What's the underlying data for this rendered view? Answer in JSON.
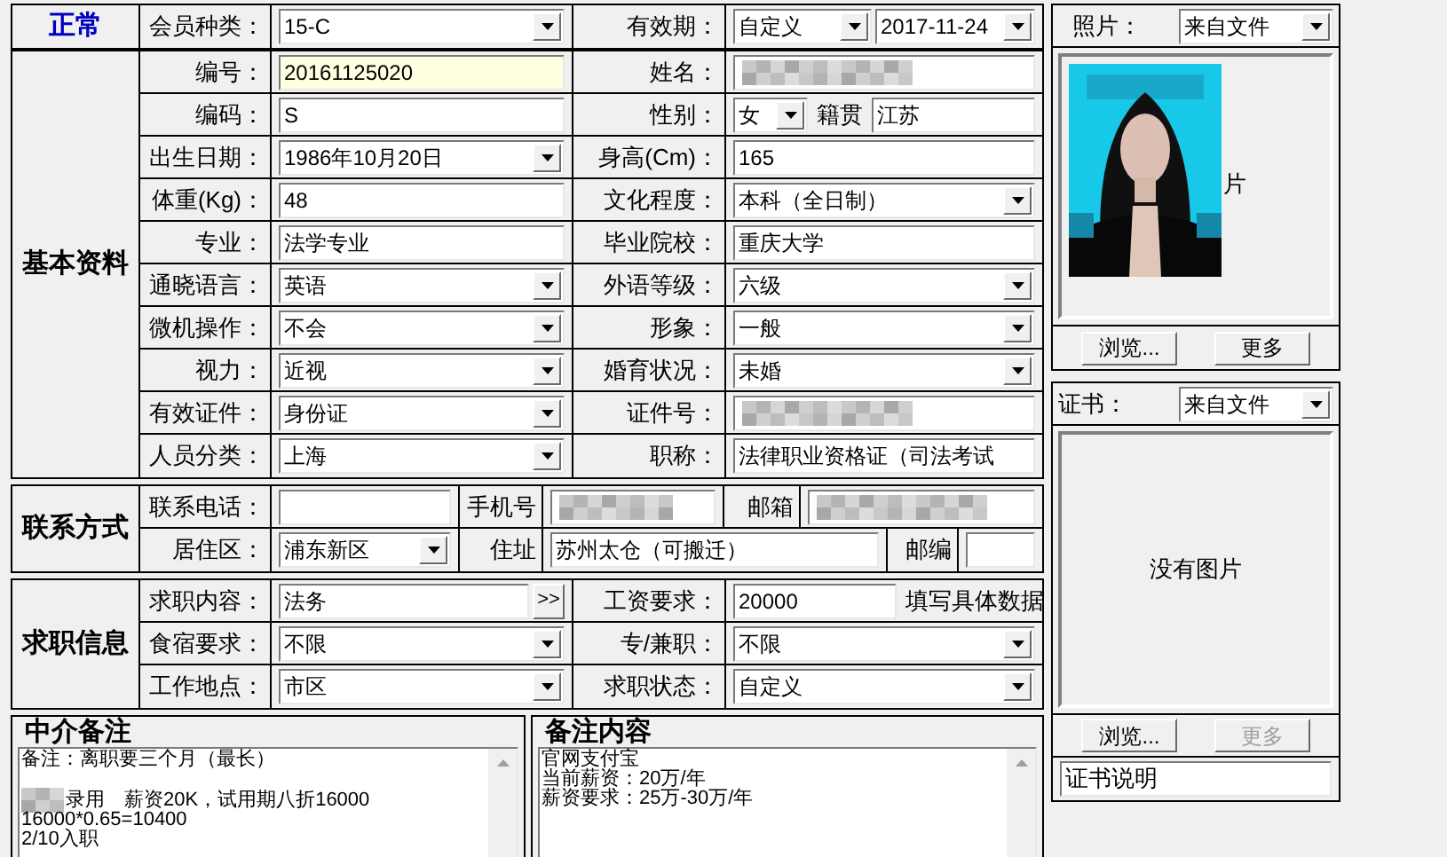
{
  "header": {
    "status": "正常",
    "cells": [
      {
        "label": "会员种类："
      },
      {
        "controls": [
          {
            "kind": "select",
            "value": "15-C"
          }
        ]
      },
      {
        "label": "有效期："
      },
      {
        "controls": [
          {
            "kind": "select_small",
            "value": "自定义"
          },
          {
            "kind": "select",
            "value": "2017-11-24"
          }
        ]
      }
    ]
  },
  "sections": [
    {
      "title": "基本资料",
      "kind": "form",
      "rows": [
        [
          {
            "label": "编号："
          },
          {
            "controls": [
              {
                "kind": "input_highlight",
                "value": "20161125020"
              }
            ]
          },
          {
            "label": "姓名："
          },
          {
            "controls": [
              {
                "kind": "redacted"
              }
            ]
          }
        ],
        [
          {
            "label": "编码："
          },
          {
            "controls": [
              {
                "kind": "input",
                "value": "S"
              }
            ]
          },
          {
            "label": "性别："
          },
          {
            "controls": [
              {
                "kind": "select_tiny",
                "value": "女"
              },
              {
                "kind": "caption",
                "text": "籍贯"
              },
              {
                "kind": "input",
                "value": "江苏"
              }
            ]
          }
        ],
        [
          {
            "label": "出生日期："
          },
          {
            "controls": [
              {
                "kind": "select",
                "value": "1986年10月20日"
              }
            ]
          },
          {
            "label": "身高(Cm)："
          },
          {
            "controls": [
              {
                "kind": "input",
                "value": "165"
              }
            ]
          }
        ],
        [
          {
            "label": "体重(Kg)："
          },
          {
            "controls": [
              {
                "kind": "input",
                "value": "48"
              }
            ]
          },
          {
            "label": "文化程度："
          },
          {
            "controls": [
              {
                "kind": "select",
                "value": "本科（全日制）"
              }
            ]
          }
        ],
        [
          {
            "label": "专业："
          },
          {
            "controls": [
              {
                "kind": "input",
                "value": "法学专业"
              }
            ]
          },
          {
            "label": "毕业院校："
          },
          {
            "controls": [
              {
                "kind": "input",
                "value": "重庆大学"
              }
            ]
          }
        ],
        [
          {
            "label": "通晓语言："
          },
          {
            "controls": [
              {
                "kind": "select",
                "value": "英语"
              }
            ]
          },
          {
            "label": "外语等级："
          },
          {
            "controls": [
              {
                "kind": "select",
                "value": "六级"
              }
            ]
          }
        ],
        [
          {
            "label": "微机操作："
          },
          {
            "controls": [
              {
                "kind": "select",
                "value": "不会"
              }
            ]
          },
          {
            "label": "形象："
          },
          {
            "controls": [
              {
                "kind": "select",
                "value": "一般"
              }
            ]
          }
        ],
        [
          {
            "label": "视力："
          },
          {
            "controls": [
              {
                "kind": "select",
                "value": "近视"
              }
            ]
          },
          {
            "label": "婚育状况："
          },
          {
            "controls": [
              {
                "kind": "select",
                "value": "未婚"
              }
            ]
          }
        ],
        [
          {
            "label": "有效证件："
          },
          {
            "controls": [
              {
                "kind": "select",
                "value": "身份证"
              }
            ]
          },
          {
            "label": "证件号："
          },
          {
            "controls": [
              {
                "kind": "redacted"
              }
            ]
          }
        ],
        [
          {
            "label": "人员分类："
          },
          {
            "controls": [
              {
                "kind": "select",
                "value": "上海"
              }
            ]
          },
          {
            "label": "职称："
          },
          {
            "controls": [
              {
                "kind": "input",
                "value": "法律职业资格证（司法考试"
              }
            ]
          }
        ]
      ]
    },
    {
      "title": "联系方式",
      "kind": "contact",
      "rows": [
        [
          {
            "label": "联系电话："
          },
          {
            "controls": [
              {
                "kind": "input"
              }
            ]
          },
          {
            "label": "手机号"
          },
          {
            "controls": [
              {
                "kind": "redacted"
              }
            ]
          },
          {
            "label": "邮箱"
          },
          {
            "controls": [
              {
                "kind": "redacted"
              }
            ]
          }
        ],
        [
          {
            "label": "居住区："
          },
          {
            "controls": [
              {
                "kind": "select",
                "value": "浦东新区"
              }
            ]
          },
          {
            "label": "住址"
          },
          {
            "controls": [
              {
                "kind": "input",
                "value": "苏州太仓（可搬迁）"
              }
            ]
          },
          {
            "label": "邮编"
          },
          {
            "controls": [
              {
                "kind": "input"
              }
            ]
          }
        ]
      ]
    },
    {
      "title": "求职信息",
      "kind": "form",
      "rows": [
        [
          {
            "label": "求职内容："
          },
          {
            "controls": [
              {
                "kind": "input",
                "value": "法务"
              },
              {
                "kind": "button",
                "text": ">>"
              }
            ]
          },
          {
            "label": "工资要求："
          },
          {
            "controls": [
              {
                "kind": "input_short",
                "value": "20000"
              },
              {
                "kind": "caption",
                "text": "填写具体数据"
              }
            ]
          }
        ],
        [
          {
            "label": "食宿要求："
          },
          {
            "controls": [
              {
                "kind": "select",
                "value": "不限"
              }
            ]
          },
          {
            "label": "专/兼职："
          },
          {
            "controls": [
              {
                "kind": "select",
                "value": "不限"
              }
            ]
          }
        ],
        [
          {
            "label": "工作地点："
          },
          {
            "controls": [
              {
                "kind": "select",
                "value": "市区"
              }
            ]
          },
          {
            "label": "求职状态："
          },
          {
            "controls": [
              {
                "kind": "select",
                "value": "自定义"
              }
            ]
          }
        ]
      ]
    }
  ],
  "notes": [
    {
      "title": "中介备注",
      "lines": [
        {
          "kind": "text",
          "text": "备注：离职要三个月（最长）"
        },
        {
          "kind": "blank"
        },
        {
          "kind": "redacted_text",
          "text": "录用　薪资20K，试用期八折16000"
        },
        {
          "kind": "text",
          "text": "16000*0.65=10400"
        },
        {
          "kind": "text",
          "text": "2/10入职"
        }
      ]
    },
    {
      "title": "备注内容",
      "lines": [
        {
          "kind": "text",
          "text": "官网支付宝"
        },
        {
          "kind": "text",
          "text": "当前薪资：20万/年"
        },
        {
          "kind": "text",
          "text": "薪资要求：25万-30万/年"
        }
      ]
    }
  ],
  "photo": {
    "label": "照片：",
    "source": "来自文件",
    "has_image": true,
    "caption": "片",
    "buttons": [
      {
        "text": "浏览...",
        "disabled": false
      },
      {
        "text": "更多",
        "disabled": false
      }
    ]
  },
  "certificate": {
    "label": "证书：",
    "source": "来自文件",
    "has_image": false,
    "caption": "没有图片",
    "buttons": [
      {
        "text": "浏览...",
        "disabled": false
      },
      {
        "text": "更多",
        "disabled": true
      }
    ],
    "description": "证书说明"
  }
}
